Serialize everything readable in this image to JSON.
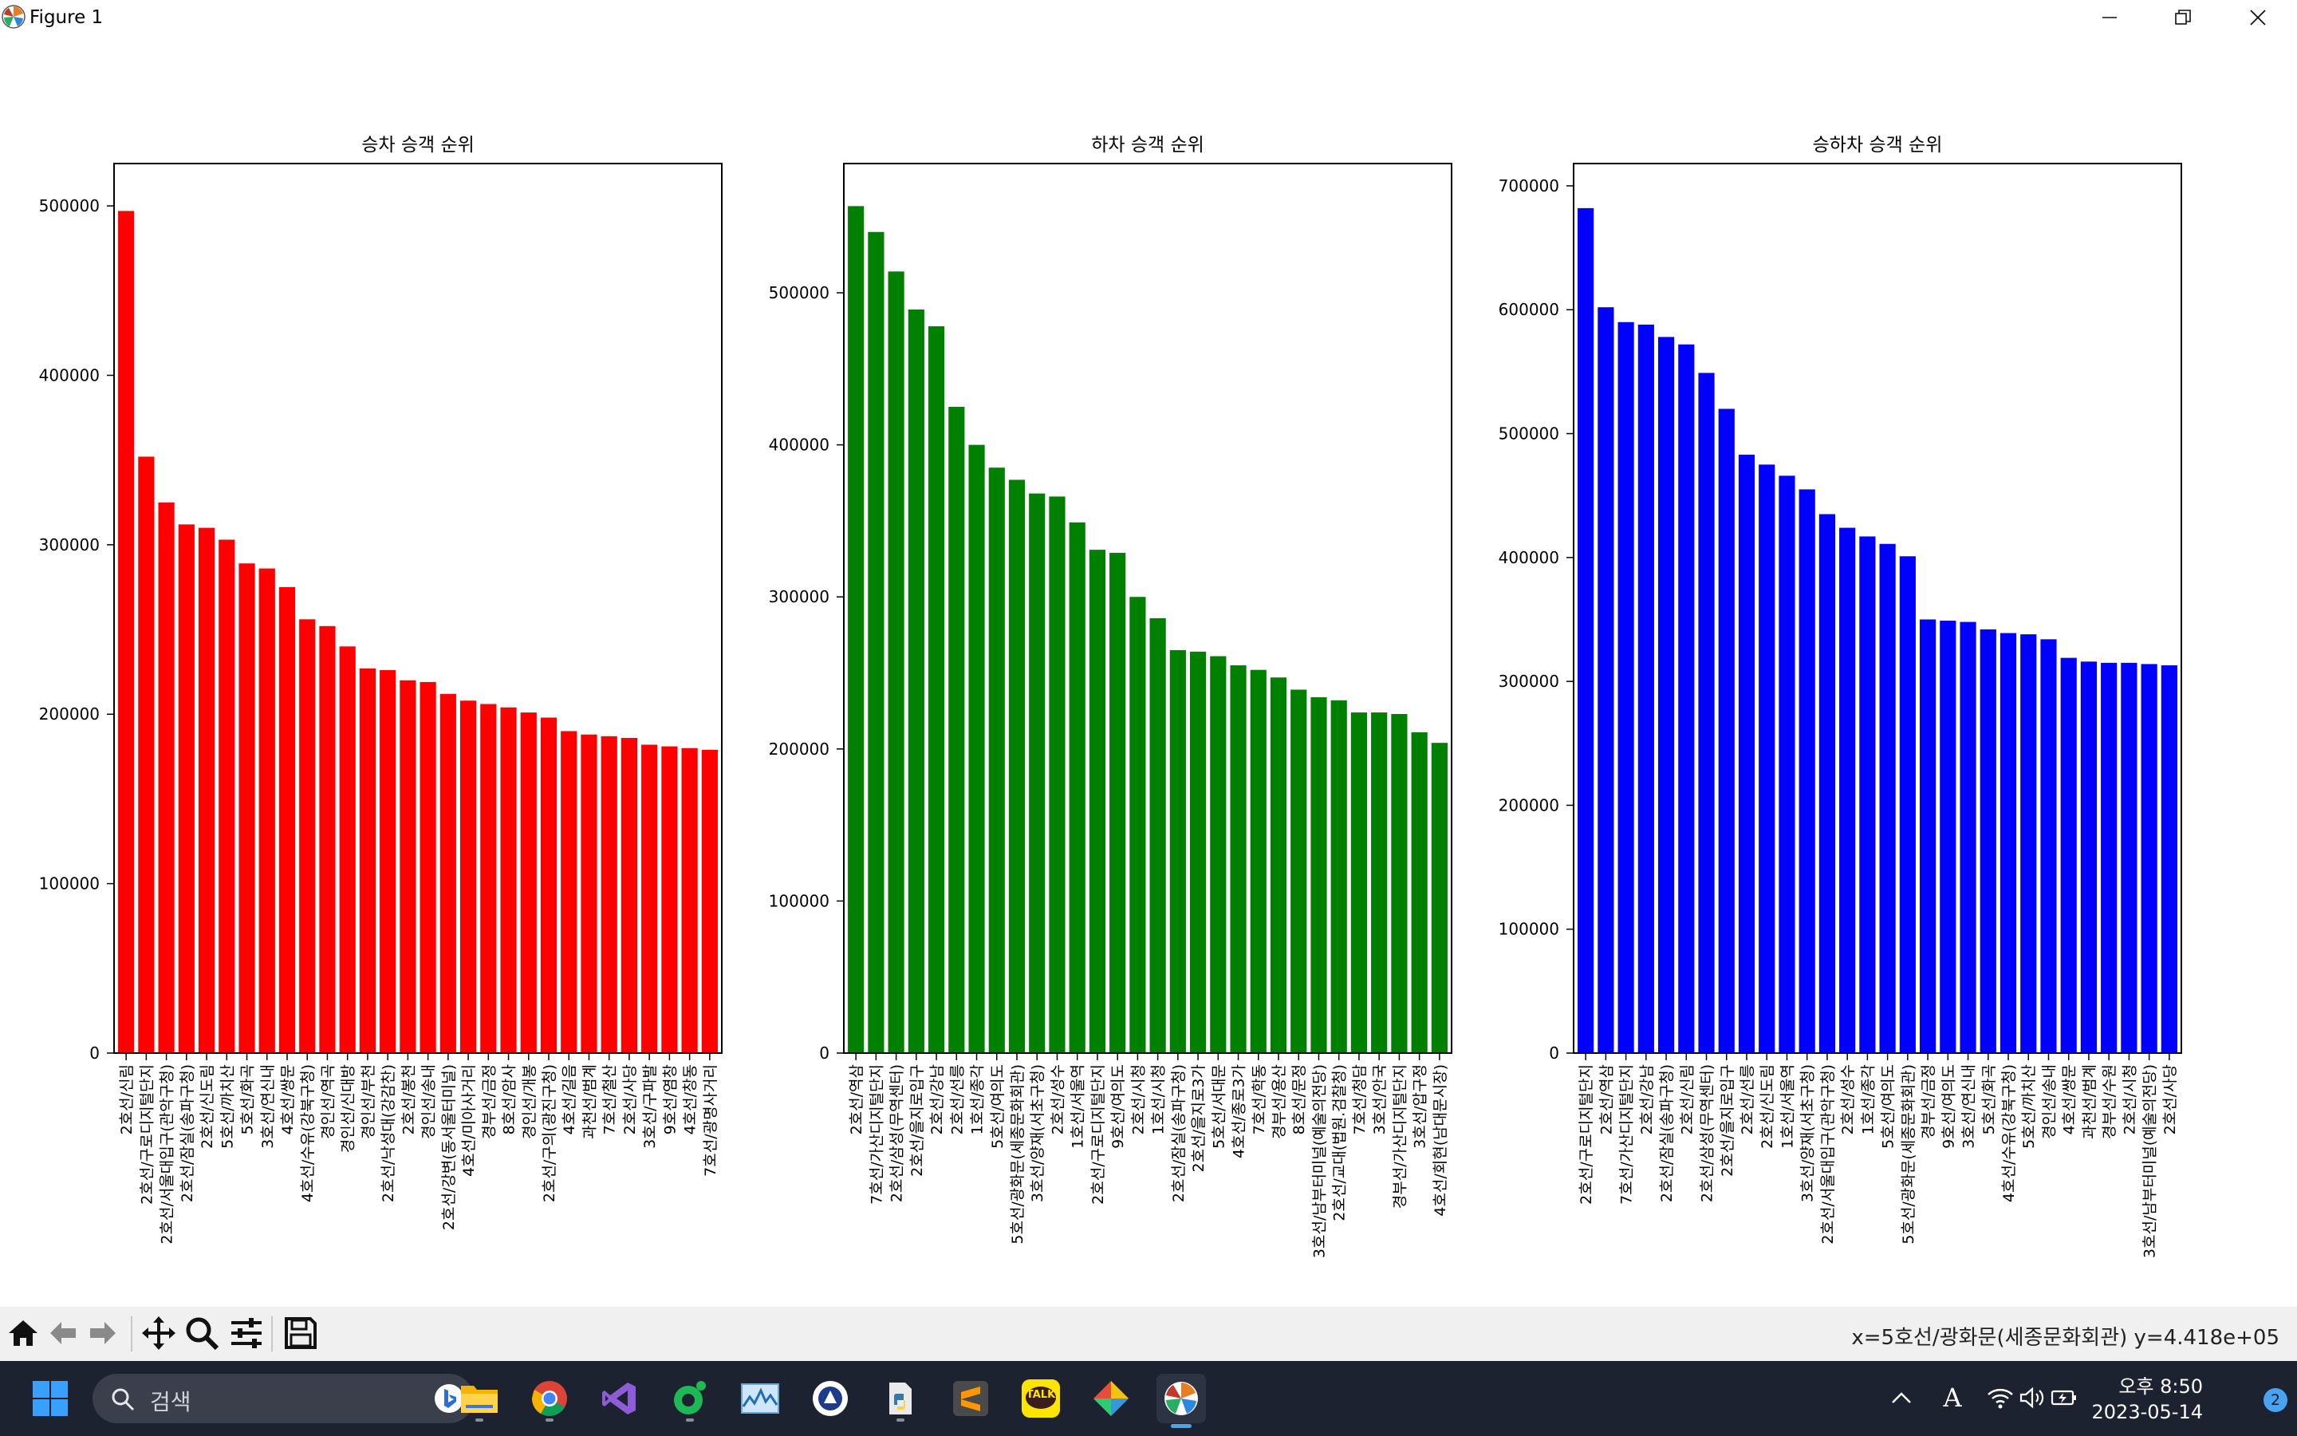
{
  "window": {
    "title": "Figure 1",
    "controls": [
      "minimize",
      "maximize",
      "close"
    ]
  },
  "charts": [
    {
      "title": "승차 승객 순위",
      "color": "#ff0000",
      "ylim": [
        0,
        525000
      ],
      "yticks": [
        0,
        100000,
        200000,
        300000,
        400000,
        500000
      ],
      "categories": [
        "2호선/신림",
        "2호선/구로디지털단지",
        "2호선/서울대입구(관악구청)",
        "2호선/잠실(송파구청)",
        "2호선/신도림",
        "5호선/까치산",
        "5호선/화곡",
        "3호선/연신내",
        "4호선/쌍문",
        "4호선/수유(강북구청)",
        "경인선/역곡",
        "경인선/신대방",
        "경인선/부천",
        "2호선/낙성대(강감찬)",
        "2호선/봉천",
        "경인선/송내",
        "2호선/강변(동서울터미널)",
        "4호선/미아사거리",
        "경부선/금정",
        "8호선/암사",
        "경인선/개봉",
        "2호선/구의(광진구청)",
        "4호선/길음",
        "과천선/범계",
        "7호선/철산",
        "2호선/사당",
        "3호선/구파발",
        "9호선/염창",
        "4호선/창동",
        "7호선/광명사거리"
      ],
      "values": [
        497000,
        352000,
        325000,
        312000,
        310000,
        303000,
        289000,
        286000,
        275000,
        256000,
        252000,
        240000,
        227000,
        226000,
        220000,
        219000,
        212000,
        208000,
        206000,
        204000,
        201000,
        198000,
        190000,
        188000,
        187000,
        186000,
        182000,
        181000,
        180000,
        179000
      ]
    },
    {
      "title": "하차 승객 순위",
      "color": "#008000",
      "ylim": [
        0,
        585000
      ],
      "yticks": [
        0,
        100000,
        200000,
        300000,
        400000,
        500000
      ],
      "categories": [
        "2호선/역삼",
        "7호선/가산디지털단지",
        "2호선/삼성(무역센터)",
        "2호선/을지로입구",
        "2호선/강남",
        "2호선/선릉",
        "1호선/종각",
        "5호선/여의도",
        "5호선/광화문(세종문화회관)",
        "3호선/양재(서초구청)",
        "2호선/성수",
        "1호선/서울역",
        "2호선/구로디지털단지",
        "9호선/여의도",
        "2호선/시청",
        "1호선/시청",
        "2호선/잠실(송파구청)",
        "2호선/을지로3가",
        "5호선/서대문",
        "4호선/종로3가",
        "7호선/학동",
        "경부선/용산",
        "8호선/문정",
        "3호선/남부터미널(예술의전당)",
        "2호선/교대(법원.검찰청)",
        "7호선/청담",
        "3호선/안국",
        "경부선/가산디지털단지",
        "3호선/압구정",
        "4호선/회현(남대문시장)"
      ],
      "values": [
        557000,
        540000,
        514000,
        489000,
        478000,
        425000,
        400000,
        385000,
        377000,
        368000,
        366000,
        349000,
        331000,
        329000,
        300000,
        286000,
        265000,
        264000,
        261000,
        255000,
        252000,
        247000,
        239000,
        234000,
        232000,
        224000,
        224000,
        223000,
        211000,
        204000
      ]
    },
    {
      "title": "승하차 승객 순위",
      "color": "#0000ff",
      "ylim": [
        0,
        718000
      ],
      "yticks": [
        0,
        100000,
        200000,
        300000,
        400000,
        500000,
        600000,
        700000
      ],
      "categories": [
        "2호선/구로디지털단지",
        "2호선/역삼",
        "7호선/가산디지털단지",
        "2호선/강남",
        "2호선/잠실(송파구청)",
        "2호선/신림",
        "2호선/삼성(무역센터)",
        "2호선/을지로입구",
        "2호선/선릉",
        "2호선/신도림",
        "1호선/서울역",
        "3호선/양재(서초구청)",
        "2호선/서울대입구(관악구청)",
        "2호선/성수",
        "1호선/종각",
        "5호선/여의도",
        "5호선/광화문(세종문화회관)",
        "경부선/금정",
        "9호선/여의도",
        "3호선/연신내",
        "5호선/화곡",
        "4호선/수유(강북구청)",
        "5호선/까치산",
        "경인선/송내",
        "4호선/쌍문",
        "과천선/범계",
        "경부선/수원",
        "2호선/시청",
        "3호선/남부터미널(예술의전당)",
        "2호선/사당"
      ],
      "values": [
        682000,
        602000,
        590000,
        588000,
        578000,
        572000,
        549000,
        520000,
        483000,
        475000,
        466000,
        455000,
        435000,
        424000,
        417000,
        411000,
        401000,
        350000,
        349000,
        348000,
        342000,
        339000,
        338000,
        334000,
        319000,
        316000,
        315000,
        315000,
        314000,
        313000
      ]
    }
  ],
  "toolbar": {
    "tools": [
      "home-icon",
      "back-arrow-icon",
      "forward-arrow-icon",
      "pan-icon",
      "zoom-icon",
      "configure-subplots-icon",
      "save-icon"
    ],
    "status": "x=5호선/광화문(세종문화회관) y=4.418e+05"
  },
  "taskbar": {
    "search_placeholder": "검색",
    "apps": [
      "file-explorer-icon",
      "chrome-icon",
      "visual-studio-icon",
      "app-green-icon",
      "resource-monitor-icon",
      "app-circle-icon",
      "python-icon",
      "sublime-text-icon",
      "kakaotalk-icon",
      "app-gem-icon",
      "matplotlib-icon"
    ],
    "kakao_label": "TALK",
    "clock_time": "오후 8:50",
    "clock_date": "2023-05-14",
    "notification_count": "2",
    "ime_label": "A"
  }
}
